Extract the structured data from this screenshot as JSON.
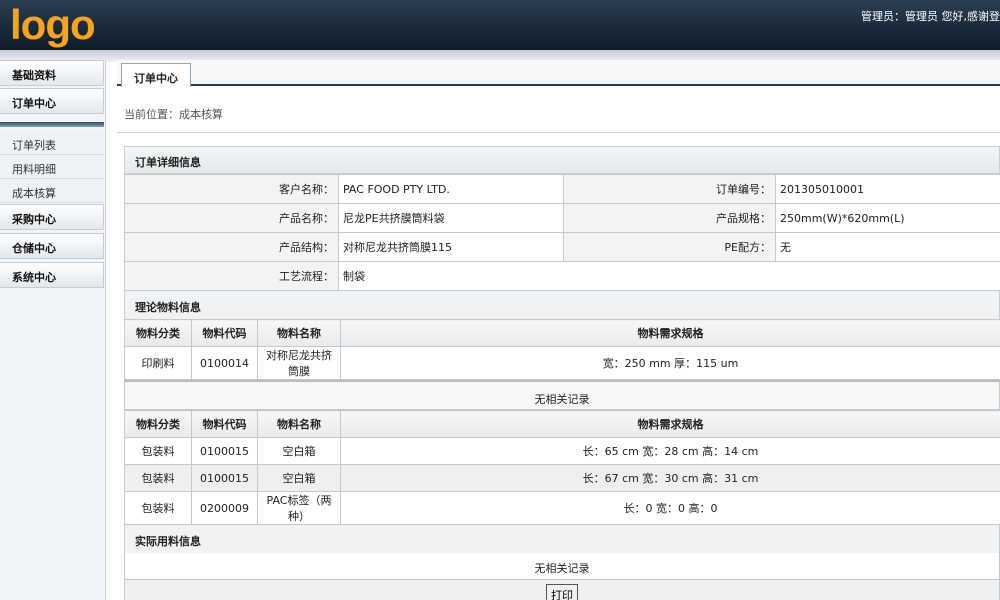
{
  "header": {
    "logo": "logo",
    "user_info": "管理员：管理员 您好,感谢登"
  },
  "sidebar": {
    "groups": [
      {
        "label": "基础资料"
      },
      {
        "label": "订单中心"
      }
    ],
    "sub_items": [
      {
        "label": "订单列表"
      },
      {
        "label": "用料明细"
      },
      {
        "label": "成本核算"
      }
    ],
    "lower_groups": [
      {
        "label": "采购中心"
      },
      {
        "label": "仓储中心"
      },
      {
        "label": "系统中心"
      }
    ]
  },
  "main": {
    "tab": "订单中心",
    "breadcrumb": "当前位置：成本核算",
    "order_section_title": "订单详细信息",
    "order_info": {
      "customer_label": "客户名称：",
      "customer_value": "PAC FOOD PTY LTD.",
      "order_no_label": "订单编号：",
      "order_no_value": "201305010001",
      "product_label": "产品名称：",
      "product_value": "尼龙PE共挤膜筒料袋",
      "spec_label": "产品规格：",
      "spec_value": "250mm(W)*620mm(L)",
      "structure_label": "产品结构：",
      "structure_value": "对称尼龙共挤筒膜115",
      "pe_label": "PE配方：",
      "pe_value": "无",
      "process_label": "工艺流程：",
      "process_value": "制袋"
    },
    "theory_title": "理论物料信息",
    "columns": {
      "category": "物料分类",
      "code": "物料代码",
      "name": "物料名称",
      "spec": "物料需求规格"
    },
    "theory_rows": [
      {
        "category": "印刷料",
        "code": "0100014",
        "name": "对称尼龙共挤筒膜",
        "spec": "宽：250 mm 厚：115 um"
      }
    ],
    "no_record": "无相关记录",
    "packaging_rows": [
      {
        "category": "包装料",
        "code": "0100015",
        "name": "空白箱",
        "spec": "长：65 cm 宽：28 cm 高：14 cm"
      },
      {
        "category": "包装料",
        "code": "0100015",
        "name": "空白箱",
        "spec": "长：67 cm 宽：30 cm 高：31 cm"
      },
      {
        "category": "包装料",
        "code": "0200009",
        "name": "PAC标签（两种）",
        "spec": "长：0 宽：0 高：0"
      }
    ],
    "actual_title": "实际用料信息",
    "actual_no_record": "无相关记录",
    "print_label": "打印"
  }
}
